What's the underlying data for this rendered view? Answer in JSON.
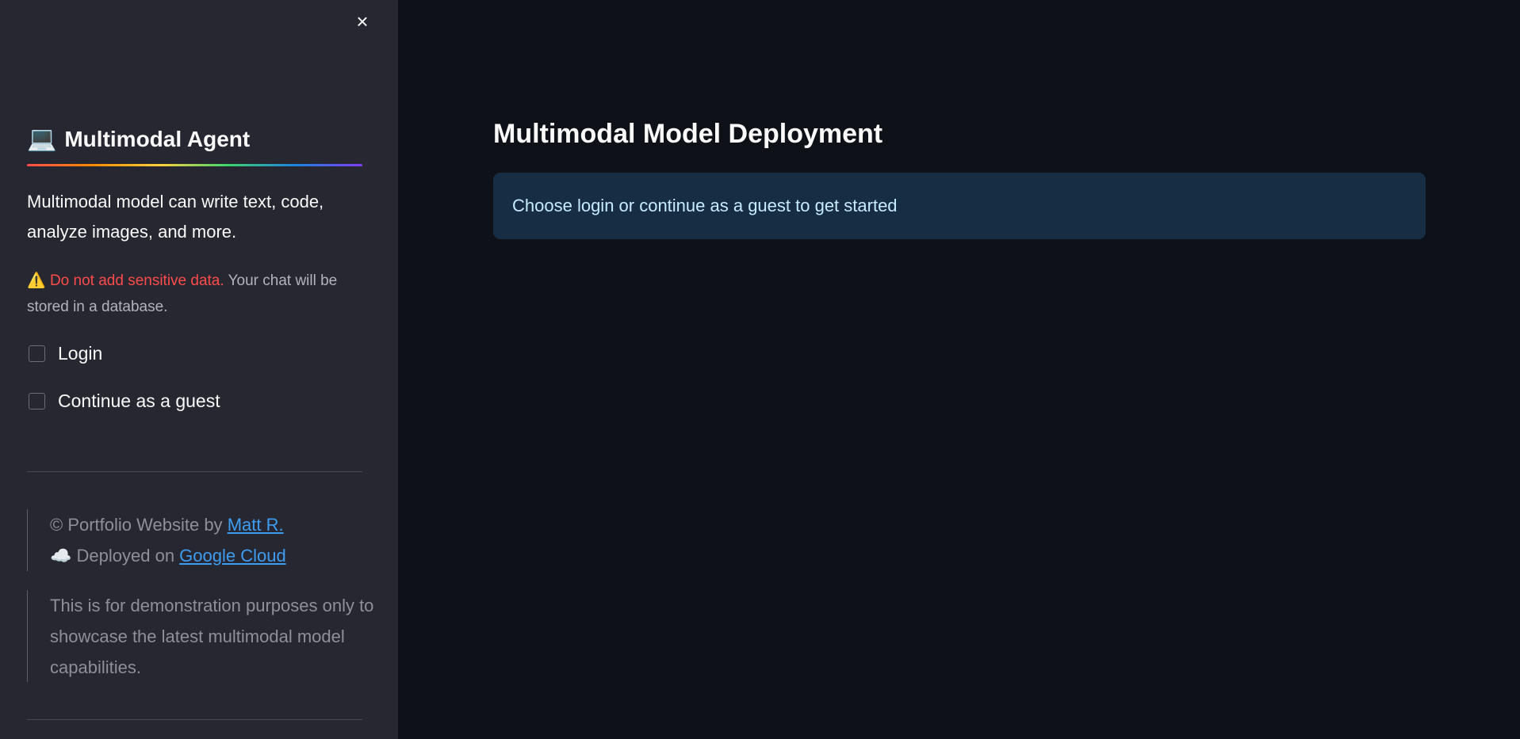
{
  "sidebar": {
    "close_icon": "×",
    "title_icon": "💻",
    "title": "Multimodal Agent",
    "description": "Multimodal model can write text, code, analyze images, and more.",
    "warning": {
      "icon": "⚠️",
      "highlight": "Do not add sensitive data.",
      "rest": " Your chat will be stored in a database."
    },
    "checkboxes": [
      {
        "label": "Login",
        "checked": false
      },
      {
        "label": "Continue as a guest",
        "checked": false
      }
    ],
    "credits": {
      "portfolio_prefix": "© Portfolio Website by ",
      "portfolio_link": "Matt R.",
      "cloud_icon": "☁️",
      "deployed_prefix": " Deployed on ",
      "deployed_link": "Google Cloud"
    },
    "disclaimer": "This is for demonstration purposes only to showcase the latest multimodal model capabilities."
  },
  "main": {
    "title": "Multimodal Model Deployment",
    "info": "Choose login or continue as a guest to get started"
  },
  "colors": {
    "sidebar_bg": "#262730",
    "main_bg": "#0e1117",
    "info_bg": "#172d43",
    "info_text": "#c7ebff",
    "warning_red": "#ff4b4b",
    "link": "#3d9df3"
  }
}
